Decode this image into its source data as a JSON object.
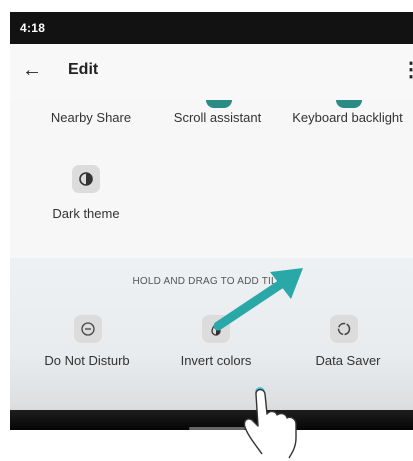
{
  "status_bar": {
    "time": "4:18"
  },
  "app_bar": {
    "title": "Edit",
    "back_icon": "arrow-left-icon",
    "menu_icon": "more-vert-icon"
  },
  "active_tiles": [
    {
      "label": "Nearby Share",
      "icon": "nearby-share-icon"
    },
    {
      "label": "Scroll assistant",
      "icon": "scroll-assistant-icon"
    },
    {
      "label": "Keyboard backlight",
      "icon": "keyboard-backlight-icon"
    },
    {
      "label": "Dark theme",
      "icon": "dark-theme-icon"
    }
  ],
  "available_tiles": {
    "hint": "HOLD AND DRAG TO ADD TILES",
    "items": [
      {
        "label": "Do Not Disturb",
        "icon": "do-not-disturb-icon"
      },
      {
        "label": "Invert colors",
        "icon": "invert-colors-icon"
      },
      {
        "label": "Data Saver",
        "icon": "data-saver-icon"
      }
    ]
  },
  "annotation": {
    "arrow_icon": "drag-arrow-icon",
    "hand_icon": "pointing-hand-icon"
  },
  "colors": {
    "accent": "#2b8c86",
    "arrow": "#2aa8a8",
    "status_bar": "#121212"
  }
}
